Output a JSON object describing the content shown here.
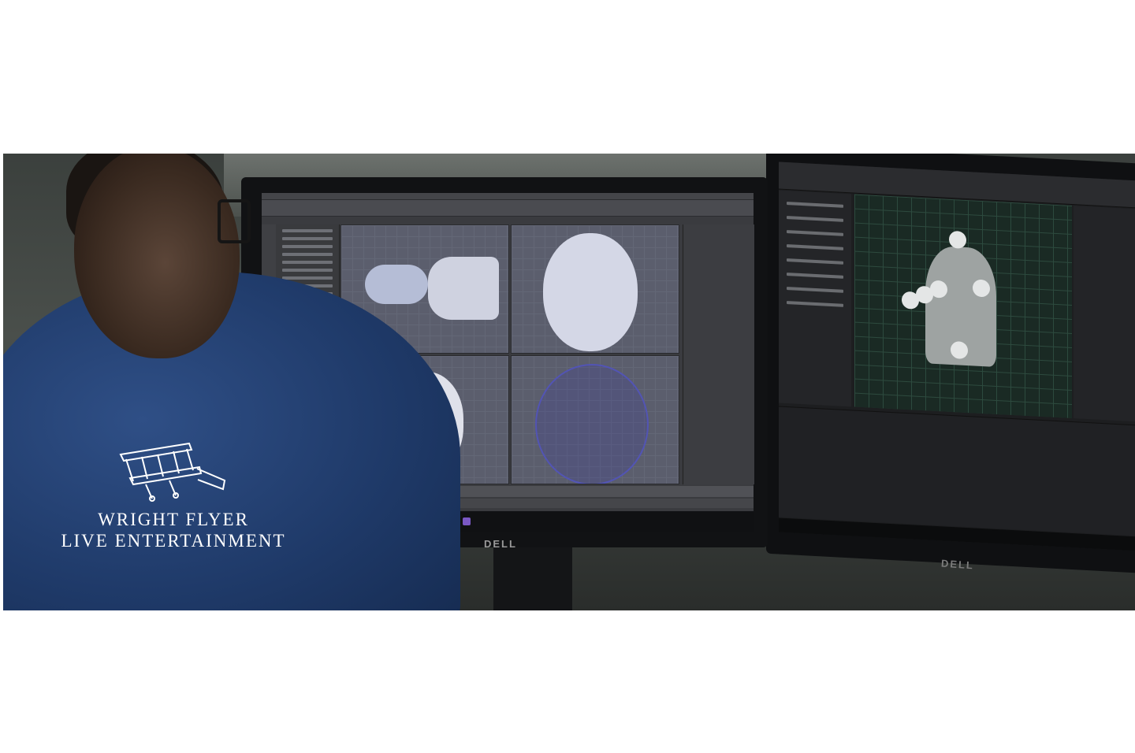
{
  "logo": {
    "line1": "WRIGHT FLYER",
    "line2": "LIVE ENTERTAINMENT"
  },
  "monitors": {
    "left_brand": "DELL",
    "right_brand": "DELL"
  },
  "colors": {
    "hoodie": "#1f3a69",
    "maya_ui": "#3a3b3f",
    "viewport": "#5b5e6d",
    "ue_viewport": "#1a2a24",
    "logo_text": "#ffffff"
  }
}
